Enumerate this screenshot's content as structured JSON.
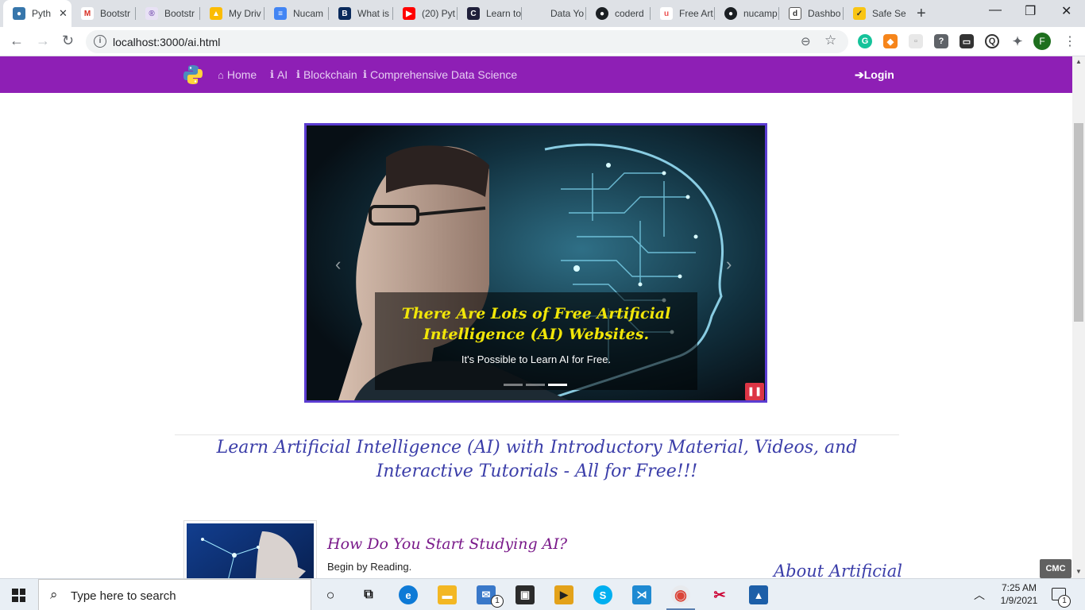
{
  "browser": {
    "tabs": [
      {
        "label": "Pyth",
        "icon": "python-icon",
        "active": true
      },
      {
        "label": "Bootstr",
        "icon": "gmail-icon"
      },
      {
        "label": "Bootstr",
        "icon": "bootstrap-icon"
      },
      {
        "label": "My Driv",
        "icon": "google-drive-icon"
      },
      {
        "label": "Nucam",
        "icon": "google-docs-icon"
      },
      {
        "label": "What is",
        "icon": "britannica-icon"
      },
      {
        "label": "(20) Pyt",
        "icon": "youtube-icon"
      },
      {
        "label": "Learn to",
        "icon": "codecademy-icon"
      },
      {
        "label": "Data Yo",
        "icon": "blank-icon"
      },
      {
        "label": "coderd",
        "icon": "github-icon"
      },
      {
        "label": "Free Art",
        "icon": "udemy-icon"
      },
      {
        "label": "nucamp",
        "icon": "github-icon"
      },
      {
        "label": "Dashbo",
        "icon": "dashboard-icon"
      },
      {
        "label": "Safe Se",
        "icon": "safe-search-icon"
      }
    ],
    "url": "localhost:3000/ai.html",
    "profile_initial": "F"
  },
  "navbar": {
    "items": [
      {
        "label": "Home",
        "icon": "home-icon"
      },
      {
        "label": "AI",
        "icon": "info-icon"
      },
      {
        "label": "Blockchain",
        "icon": "info-icon"
      },
      {
        "label": "Comprehensive Data Science",
        "icon": "info-icon"
      }
    ],
    "login_label": "Login"
  },
  "carousel": {
    "caption_title": "There Are Lots of Free Artificial Intelligence (AI) Websites.",
    "caption_sub": "It's Possible to Learn AI for Free.",
    "slide_count": 3,
    "active_slide": 3
  },
  "headline": "Learn Artificial Intelligence (AI) with Introductory Material, Videos, and Interactive Tutorials - All for Free!!!",
  "study": {
    "title": "How Do You Start Studying AI?",
    "text": "Begin by Reading."
  },
  "about_title": "About Artificial",
  "cmc_badge": "CMC",
  "taskbar": {
    "search_placeholder": "Type here to search",
    "time": "7:25 AM",
    "date": "1/9/2021",
    "mail_badge": "1",
    "notification_count": "1"
  },
  "colors": {
    "navbar": "#8e1fb5",
    "carousel_border": "#5b3cd1",
    "caption_title": "#f1e608",
    "headline": "#3b3ea9",
    "study_title": "#7a1a8a"
  }
}
